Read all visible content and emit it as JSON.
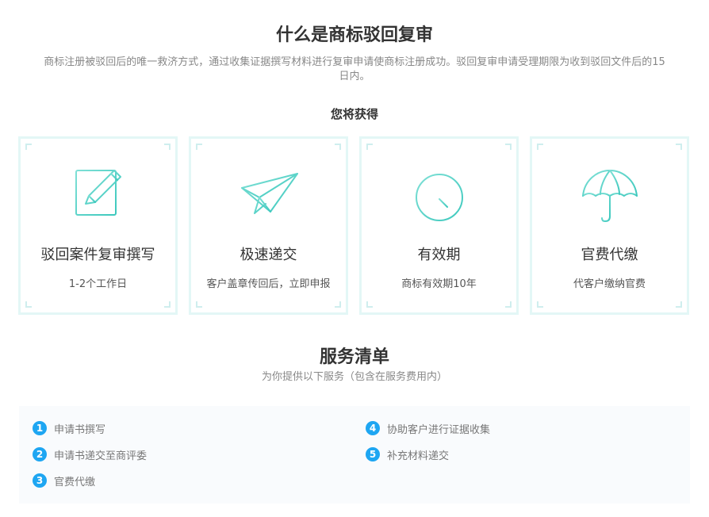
{
  "header": {
    "title": "什么是商标驳回复审",
    "description": "商标注册被驳回后的唯一救济方式，通过收集证据撰写材料进行复审申请使商标注册成功。驳回复审申请受理期限为收到驳回文件后的15日内。",
    "subtitle": "您将获得"
  },
  "colors": {
    "accent": "#4fd1c5",
    "card_border": "#e3f7f6",
    "badge": "#1ea6f2"
  },
  "cards": [
    {
      "icon": "document-pencil-icon",
      "title": "驳回案件复审撰写",
      "subtitle": "1-2个工作日"
    },
    {
      "icon": "paper-plane-icon",
      "title": "极速递交",
      "subtitle": "客户盖章传回后，立即申报"
    },
    {
      "icon": "stopwatch-icon",
      "title": "有效期",
      "subtitle": "商标有效期10年"
    },
    {
      "icon": "umbrella-icon",
      "title": "官费代缴",
      "subtitle": "代客户缴纳官费"
    }
  ],
  "services": {
    "title": "服务清单",
    "subtitle": "为你提供以下服务（包含在服务费用内）",
    "items": [
      {
        "num": "1",
        "label": "申请书撰写"
      },
      {
        "num": "2",
        "label": "申请书递交至商评委"
      },
      {
        "num": "3",
        "label": "官费代缴"
      },
      {
        "num": "4",
        "label": "协助客户进行证据收集"
      },
      {
        "num": "5",
        "label": "补充材料递交"
      }
    ]
  }
}
